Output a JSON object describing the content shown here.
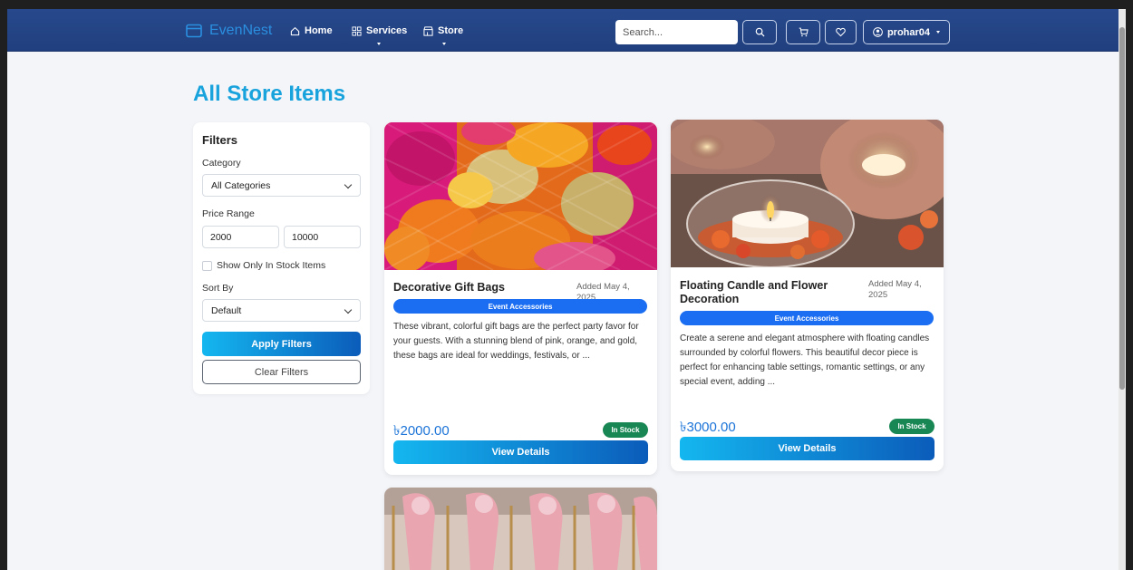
{
  "navbar": {
    "brand": "EvenNest",
    "links": [
      {
        "label": "Home"
      },
      {
        "label": "Services"
      },
      {
        "label": "Store"
      }
    ],
    "search_placeholder": "Search...",
    "username": "prohar04"
  },
  "page": {
    "title": "All Store Items"
  },
  "filters": {
    "title": "Filters",
    "category_label": "Category",
    "category_value": "All Categories",
    "price_label": "Price Range",
    "price_min": "2000",
    "price_max": "10000",
    "in_stock_label": "Show Only In Stock Items",
    "in_stock_checked": false,
    "sort_label": "Sort By",
    "sort_value": "Default",
    "apply_label": "Apply Filters",
    "clear_label": "Clear Filters"
  },
  "products": [
    {
      "title": "Decorative Gift Bags",
      "date": "Added May 4, 2025",
      "category": "Event Accessories",
      "description": "These vibrant, colorful gift bags are the perfect party favor for your guests. With a stunning blend of pink, orange, and gold, these bags are ideal for weddings, festivals, or ...",
      "price": "৳2000.00",
      "stock": "In Stock",
      "button": "View Details"
    },
    {
      "title": "Floating Candle and Flower Decoration",
      "date": "Added May 4, 2025",
      "category": "Event Accessories",
      "description": "Create a serene and elegant atmosphere with floating candles surrounded by colorful flowers. This beautiful decor piece is perfect for enhancing table settings, romantic settings, or any special event, adding ...",
      "price": "৳3000.00",
      "stock": "In Stock",
      "button": "View Details"
    }
  ],
  "colors": {
    "navbar": "#24458a",
    "accent": "#19a3dd",
    "badge": "#1b6ef2",
    "stock": "#198754",
    "price": "#1c74d8"
  }
}
